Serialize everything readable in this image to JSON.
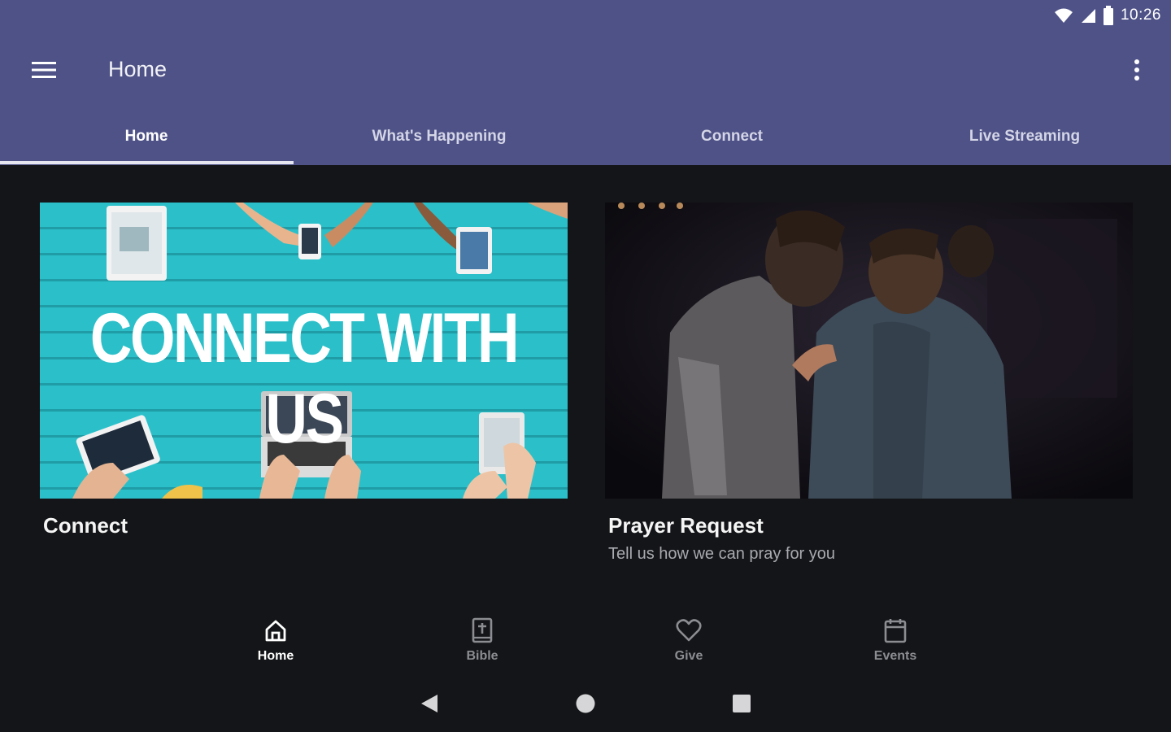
{
  "status": {
    "time": "10:26"
  },
  "toolbar": {
    "title": "Home"
  },
  "tabs": [
    {
      "label": "Home",
      "active": true
    },
    {
      "label": "What's Happening",
      "active": false
    },
    {
      "label": "Connect",
      "active": false
    },
    {
      "label": "Live Streaming",
      "active": false
    }
  ],
  "cards": {
    "connect": {
      "image_text": "CONNECT WITH US",
      "title": "Connect",
      "subtitle": ""
    },
    "prayer": {
      "title": "Prayer Request",
      "subtitle": "Tell us how we can pray for you"
    }
  },
  "bottom_nav": [
    {
      "label": "Home",
      "icon": "home-icon",
      "active": true
    },
    {
      "label": "Bible",
      "icon": "bible-icon",
      "active": false
    },
    {
      "label": "Give",
      "icon": "heart-icon",
      "active": false
    },
    {
      "label": "Events",
      "icon": "calendar-icon",
      "active": false
    }
  ],
  "colors": {
    "appbar": "#4e5287",
    "background": "#141518",
    "connect_accent": "#2bc0c9"
  }
}
